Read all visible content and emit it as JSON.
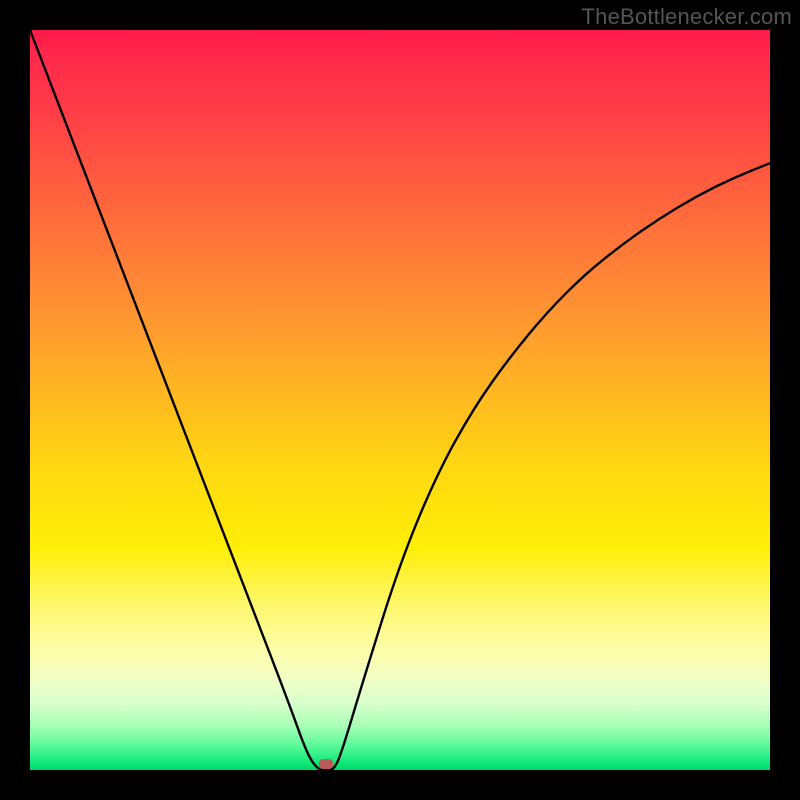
{
  "chart_data": {
    "type": "line",
    "title": "",
    "xlabel": "",
    "ylabel": "",
    "xlim": [
      0,
      1
    ],
    "ylim": [
      0,
      1
    ],
    "grid": false,
    "legend_position": "none",
    "x": [
      0.0,
      0.05,
      0.1,
      0.15,
      0.2,
      0.25,
      0.3,
      0.35,
      0.375,
      0.39,
      0.4,
      0.41,
      0.42,
      0.45,
      0.5,
      0.55,
      0.6,
      0.65,
      0.7,
      0.75,
      0.8,
      0.85,
      0.9,
      0.95,
      1.0
    ],
    "values": [
      1.0,
      0.87,
      0.74,
      0.61,
      0.48,
      0.35,
      0.22,
      0.09,
      0.02,
      0.0,
      0.0,
      0.0,
      0.02,
      0.12,
      0.28,
      0.4,
      0.49,
      0.56,
      0.62,
      0.67,
      0.71,
      0.745,
      0.775,
      0.8,
      0.82
    ],
    "marker": {
      "x": 0.4,
      "y": 0.008
    },
    "annotations": []
  },
  "watermark": {
    "text": "TheBottlenecker.com"
  },
  "colors": {
    "curve": "#000000",
    "marker": "#bb5a5a",
    "background_top": "#ff1a4a",
    "background_bottom": "#00d968"
  }
}
